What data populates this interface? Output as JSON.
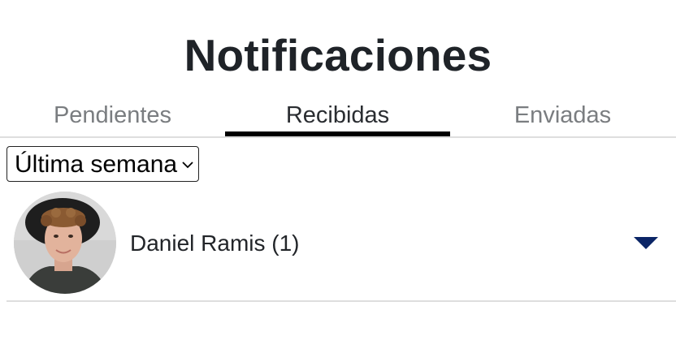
{
  "header": {
    "title": "Notificaciones"
  },
  "tabs": [
    {
      "label": "Pendientes",
      "active": false
    },
    {
      "label": "Recibidas",
      "active": true
    },
    {
      "label": "Enviadas",
      "active": false
    }
  ],
  "filter": {
    "selected": "Última semana"
  },
  "notifications": [
    {
      "sender": "Daniel Ramis (1)",
      "avatar": "avatar-photo",
      "expand_icon": "caret-down-icon"
    }
  ],
  "colors": {
    "active_tab_underline": "#000000",
    "caret": "#0b2566",
    "inactive_tab_text": "#7a7d80",
    "divider": "#dedede"
  }
}
